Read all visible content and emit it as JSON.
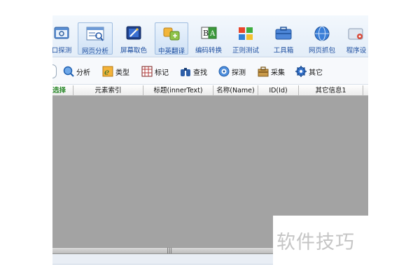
{
  "toolbar": {
    "items": [
      {
        "label": "口探测",
        "icon": "window-probe-icon"
      },
      {
        "label": "网页分析",
        "icon": "webpage-analyze-icon",
        "active": true
      },
      {
        "label": "屏幕取色",
        "icon": "color-picker-icon"
      },
      {
        "label": "中英翻译",
        "icon": "translate-icon",
        "active": true
      },
      {
        "label": "编码转换",
        "icon": "encoding-convert-icon"
      },
      {
        "label": "正则测试",
        "icon": "regex-test-icon"
      },
      {
        "label": "工具箱",
        "icon": "toolbox-icon"
      },
      {
        "label": "网页抓包",
        "icon": "packet-capture-icon"
      },
      {
        "label": "程序设",
        "icon": "program-settings-icon"
      }
    ]
  },
  "subtoolbar": {
    "items": [
      {
        "label": "分析",
        "icon": "analyze-magnifier-icon"
      },
      {
        "label": "类型",
        "icon": "ie-type-icon"
      },
      {
        "label": "标记",
        "icon": "mark-grid-icon"
      },
      {
        "label": "查找",
        "icon": "binoculars-icon"
      },
      {
        "label": "探测",
        "icon": "probe-target-icon"
      },
      {
        "label": "采集",
        "icon": "collect-bag-icon"
      },
      {
        "label": "其它",
        "icon": "other-gear-icon"
      }
    ]
  },
  "table": {
    "columns": [
      "选择",
      "元素索引",
      "标题(innerText)",
      "名称(Name)",
      "ID(Id)",
      "其它信息1"
    ],
    "rows": []
  },
  "splitter": {
    "grip": "|||"
  },
  "watermark": {
    "text": "软件技巧"
  },
  "colors": {
    "accent": "#1f4fa0",
    "grid_body": "#a3a3a3",
    "select_header": "#2e8b2e"
  }
}
